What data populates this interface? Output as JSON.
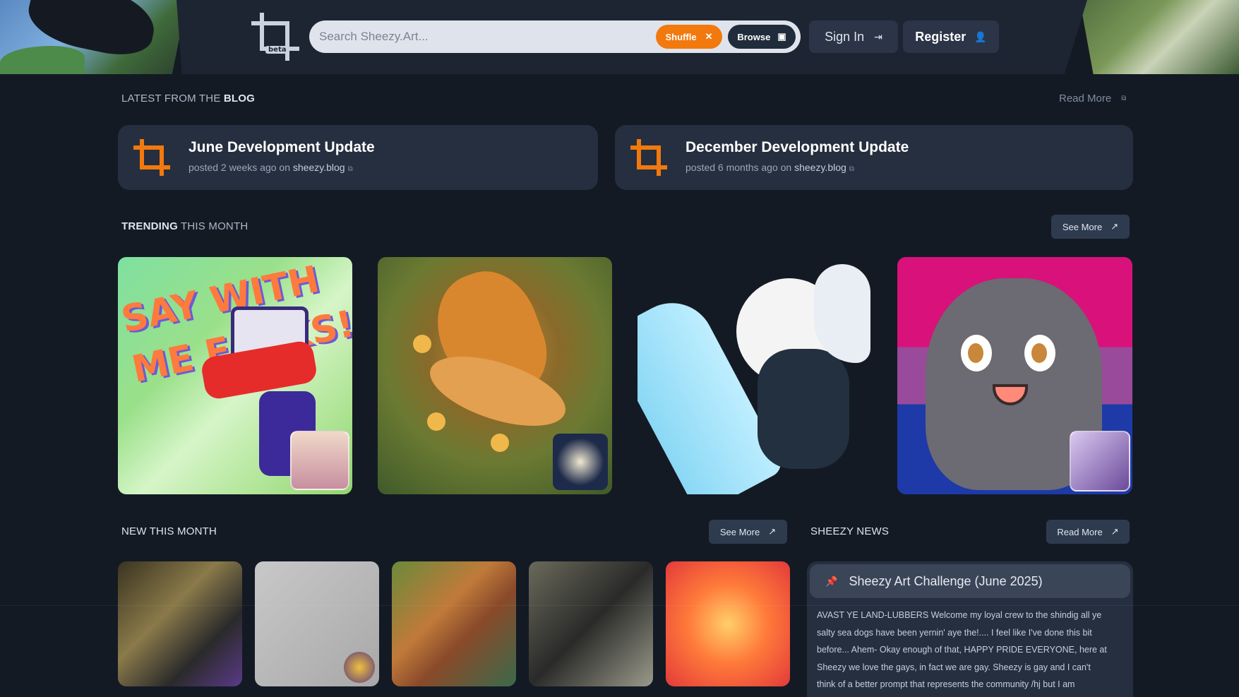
{
  "header": {
    "logo_badge": "beta",
    "search_placeholder": "Search Sheezy.Art...",
    "shuffle_label": "Shuffle",
    "browse_label": "Browse",
    "signin_label": "Sign In",
    "register_label": "Register"
  },
  "blog": {
    "title_prefix": "LATEST FROM THE ",
    "title_bold": "BLOG",
    "read_more": "Read More",
    "posts": [
      {
        "title": "June Development Update",
        "meta_prefix": "posted 2 weeks ago on ",
        "site": "sheezy.blog"
      },
      {
        "title": "December Development Update",
        "meta_prefix": "posted 6 months ago on ",
        "site": "sheezy.blog"
      }
    ]
  },
  "trending": {
    "title_bold": "TRENDING",
    "title_rest": " THIS MONTH",
    "see_more": "See More",
    "art_text": "SAY WITH ME FOLKS!"
  },
  "new_this_month": {
    "title": "NEW THIS MONTH",
    "see_more": "See More"
  },
  "news": {
    "title": "SHEEZY NEWS",
    "read_more": "Read More",
    "pinned_title": "Sheezy Art Challenge (June 2025)",
    "lines": [
      "AVAST YE LAND-LUBBERS Welcome my loyal crew to the shindig all ye",
      "salty sea dogs have been yernin' aye the!.... I feel like I've done this bit",
      "before... Ahem- Okay enough of that, HAPPY PRIDE EVERYONE, here at",
      "Sheezy we love the gays, in fact we are gay. Sheezy is gay and I can't",
      "think of a better prompt that represents the community /hj but I am"
    ]
  },
  "colors": {
    "accent": "#f2790d",
    "background": "#141a24",
    "card": "#262f3f"
  }
}
